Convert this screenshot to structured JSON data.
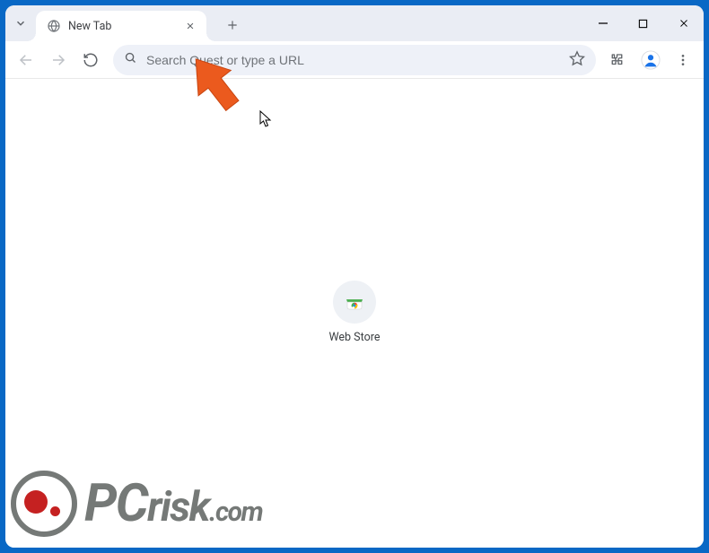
{
  "titlebar": {
    "tab_title": "New Tab"
  },
  "omnibox": {
    "placeholder": "Search Quest or type a URL"
  },
  "shortcuts": [
    {
      "label": "Web Store",
      "icon": "webstore"
    }
  ],
  "watermark": {
    "brand_pc": "PC",
    "brand_rest": "risk",
    "brand_ext": ".com"
  }
}
